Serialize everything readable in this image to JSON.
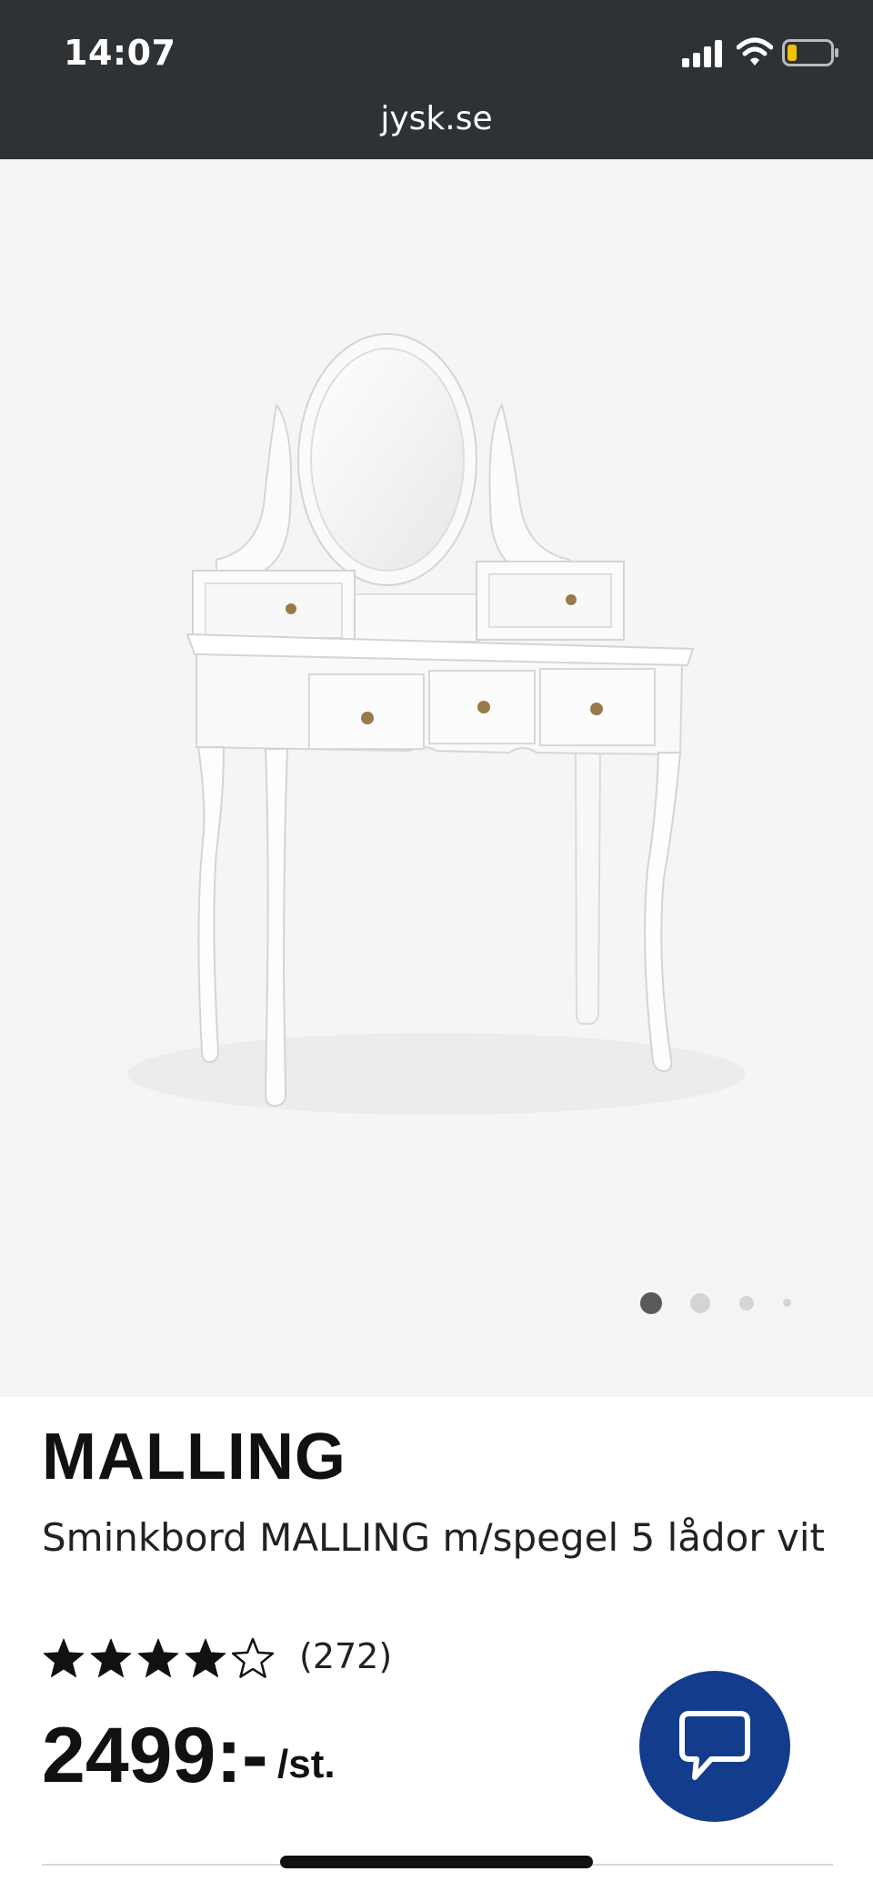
{
  "status_bar": {
    "time": "14:07",
    "url": "jysk.se"
  },
  "colors": {
    "status_bar_bg": "#2f3235",
    "hero_bg": "#f5f5f5",
    "chat_button": "#143c8c",
    "battery_level": "#f2c200",
    "star": "#111111"
  },
  "icons": [
    "signal-icon",
    "wifi-icon",
    "battery-icon",
    "star-icon",
    "chat-icon"
  ],
  "carousel": {
    "slides": 4,
    "active_index": 0
  },
  "product": {
    "brand": "MALLING",
    "name": "Sminkbord MALLING m/spegel 5 lådor vit",
    "rating": 4,
    "rating_max": 5,
    "review_count": "(272)",
    "price": "2499:-",
    "unit": "/st."
  }
}
